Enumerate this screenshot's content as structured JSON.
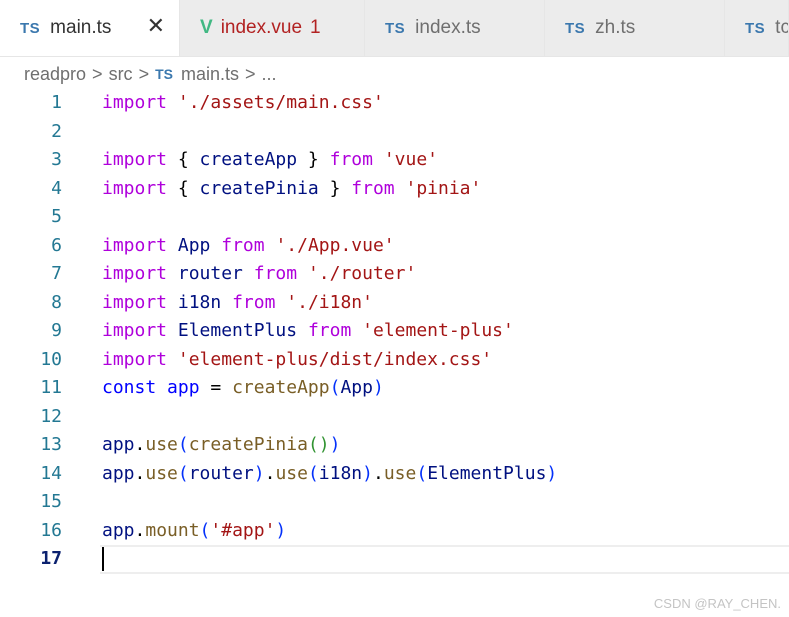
{
  "tabs": [
    {
      "badge": "TS",
      "label": "main.ts",
      "close": "✕"
    },
    {
      "icon": "V",
      "label": "index.vue",
      "count": "1"
    },
    {
      "badge": "TS",
      "label": "index.ts"
    },
    {
      "badge": "TS",
      "label": "zh.ts"
    },
    {
      "badge": "TS",
      "label": "tc"
    }
  ],
  "breadcrumb": {
    "items": [
      "readpro",
      "src"
    ],
    "file_badge": "TS",
    "file": "main.ts",
    "more": "...",
    "separator": ">"
  },
  "lines": [
    {
      "n": "1",
      "tokens": [
        {
          "t": "import",
          "c": "kw"
        },
        {
          "t": " ",
          "c": "plain"
        },
        {
          "t": "'./assets/main.css'",
          "c": "str"
        }
      ]
    },
    {
      "n": "2",
      "tokens": []
    },
    {
      "n": "3",
      "tokens": [
        {
          "t": "import",
          "c": "kw"
        },
        {
          "t": " { ",
          "c": "plain"
        },
        {
          "t": "createApp",
          "c": "id"
        },
        {
          "t": " } ",
          "c": "plain"
        },
        {
          "t": "from",
          "c": "kw"
        },
        {
          "t": " ",
          "c": "plain"
        },
        {
          "t": "'vue'",
          "c": "str"
        }
      ]
    },
    {
      "n": "4",
      "tokens": [
        {
          "t": "import",
          "c": "kw"
        },
        {
          "t": " { ",
          "c": "plain"
        },
        {
          "t": "createPinia",
          "c": "id"
        },
        {
          "t": " } ",
          "c": "plain"
        },
        {
          "t": "from",
          "c": "kw"
        },
        {
          "t": " ",
          "c": "plain"
        },
        {
          "t": "'pinia'",
          "c": "str"
        }
      ]
    },
    {
      "n": "5",
      "tokens": []
    },
    {
      "n": "6",
      "tokens": [
        {
          "t": "import",
          "c": "kw"
        },
        {
          "t": " ",
          "c": "plain"
        },
        {
          "t": "App",
          "c": "id"
        },
        {
          "t": " ",
          "c": "plain"
        },
        {
          "t": "from",
          "c": "kw"
        },
        {
          "t": " ",
          "c": "plain"
        },
        {
          "t": "'./App.vue'",
          "c": "str"
        }
      ]
    },
    {
      "n": "7",
      "tokens": [
        {
          "t": "import",
          "c": "kw"
        },
        {
          "t": " ",
          "c": "plain"
        },
        {
          "t": "router",
          "c": "id"
        },
        {
          "t": " ",
          "c": "plain"
        },
        {
          "t": "from",
          "c": "kw"
        },
        {
          "t": " ",
          "c": "plain"
        },
        {
          "t": "'./router'",
          "c": "str"
        }
      ]
    },
    {
      "n": "8",
      "tokens": [
        {
          "t": "import",
          "c": "kw"
        },
        {
          "t": " ",
          "c": "plain"
        },
        {
          "t": "i18n",
          "c": "id"
        },
        {
          "t": " ",
          "c": "plain"
        },
        {
          "t": "from",
          "c": "kw"
        },
        {
          "t": " ",
          "c": "plain"
        },
        {
          "t": "'./i18n'",
          "c": "str"
        }
      ]
    },
    {
      "n": "9",
      "tokens": [
        {
          "t": "import",
          "c": "kw"
        },
        {
          "t": " ",
          "c": "plain"
        },
        {
          "t": "ElementPlus",
          "c": "id"
        },
        {
          "t": " ",
          "c": "plain"
        },
        {
          "t": "from",
          "c": "kw"
        },
        {
          "t": " ",
          "c": "plain"
        },
        {
          "t": "'element-plus'",
          "c": "str"
        }
      ]
    },
    {
      "n": "10",
      "tokens": [
        {
          "t": "import",
          "c": "kw"
        },
        {
          "t": " ",
          "c": "plain"
        },
        {
          "t": "'element-plus/dist/index.css'",
          "c": "str"
        }
      ]
    },
    {
      "n": "11",
      "tokens": [
        {
          "t": "const",
          "c": "kwd"
        },
        {
          "t": " ",
          "c": "plain"
        },
        {
          "t": "app",
          "c": "kwd"
        },
        {
          "t": " = ",
          "c": "plain"
        },
        {
          "t": "createApp",
          "c": "fn"
        },
        {
          "t": "(",
          "c": "br1"
        },
        {
          "t": "App",
          "c": "id"
        },
        {
          "t": ")",
          "c": "br1"
        }
      ]
    },
    {
      "n": "12",
      "tokens": []
    },
    {
      "n": "13",
      "tokens": [
        {
          "t": "app",
          "c": "id"
        },
        {
          "t": ".",
          "c": "plain"
        },
        {
          "t": "use",
          "c": "fn"
        },
        {
          "t": "(",
          "c": "br1"
        },
        {
          "t": "createPinia",
          "c": "fn"
        },
        {
          "t": "()",
          "c": "br2"
        },
        {
          "t": ")",
          "c": "br1"
        }
      ]
    },
    {
      "n": "14",
      "tokens": [
        {
          "t": "app",
          "c": "id"
        },
        {
          "t": ".",
          "c": "plain"
        },
        {
          "t": "use",
          "c": "fn"
        },
        {
          "t": "(",
          "c": "br1"
        },
        {
          "t": "router",
          "c": "id"
        },
        {
          "t": ")",
          "c": "br1"
        },
        {
          "t": ".",
          "c": "plain"
        },
        {
          "t": "use",
          "c": "fn"
        },
        {
          "t": "(",
          "c": "br1"
        },
        {
          "t": "i18n",
          "c": "id"
        },
        {
          "t": ")",
          "c": "br1"
        },
        {
          "t": ".",
          "c": "plain"
        },
        {
          "t": "use",
          "c": "fn"
        },
        {
          "t": "(",
          "c": "br1"
        },
        {
          "t": "ElementPlus",
          "c": "id"
        },
        {
          "t": ")",
          "c": "br1"
        }
      ]
    },
    {
      "n": "15",
      "tokens": []
    },
    {
      "n": "16",
      "tokens": [
        {
          "t": "app",
          "c": "id"
        },
        {
          "t": ".",
          "c": "plain"
        },
        {
          "t": "mount",
          "c": "fn"
        },
        {
          "t": "(",
          "c": "br1"
        },
        {
          "t": "'#app'",
          "c": "str"
        },
        {
          "t": ")",
          "c": "br1"
        }
      ]
    },
    {
      "n": "17",
      "tokens": [],
      "current": true
    }
  ],
  "watermark": "CSDN @RAY_CHEN."
}
